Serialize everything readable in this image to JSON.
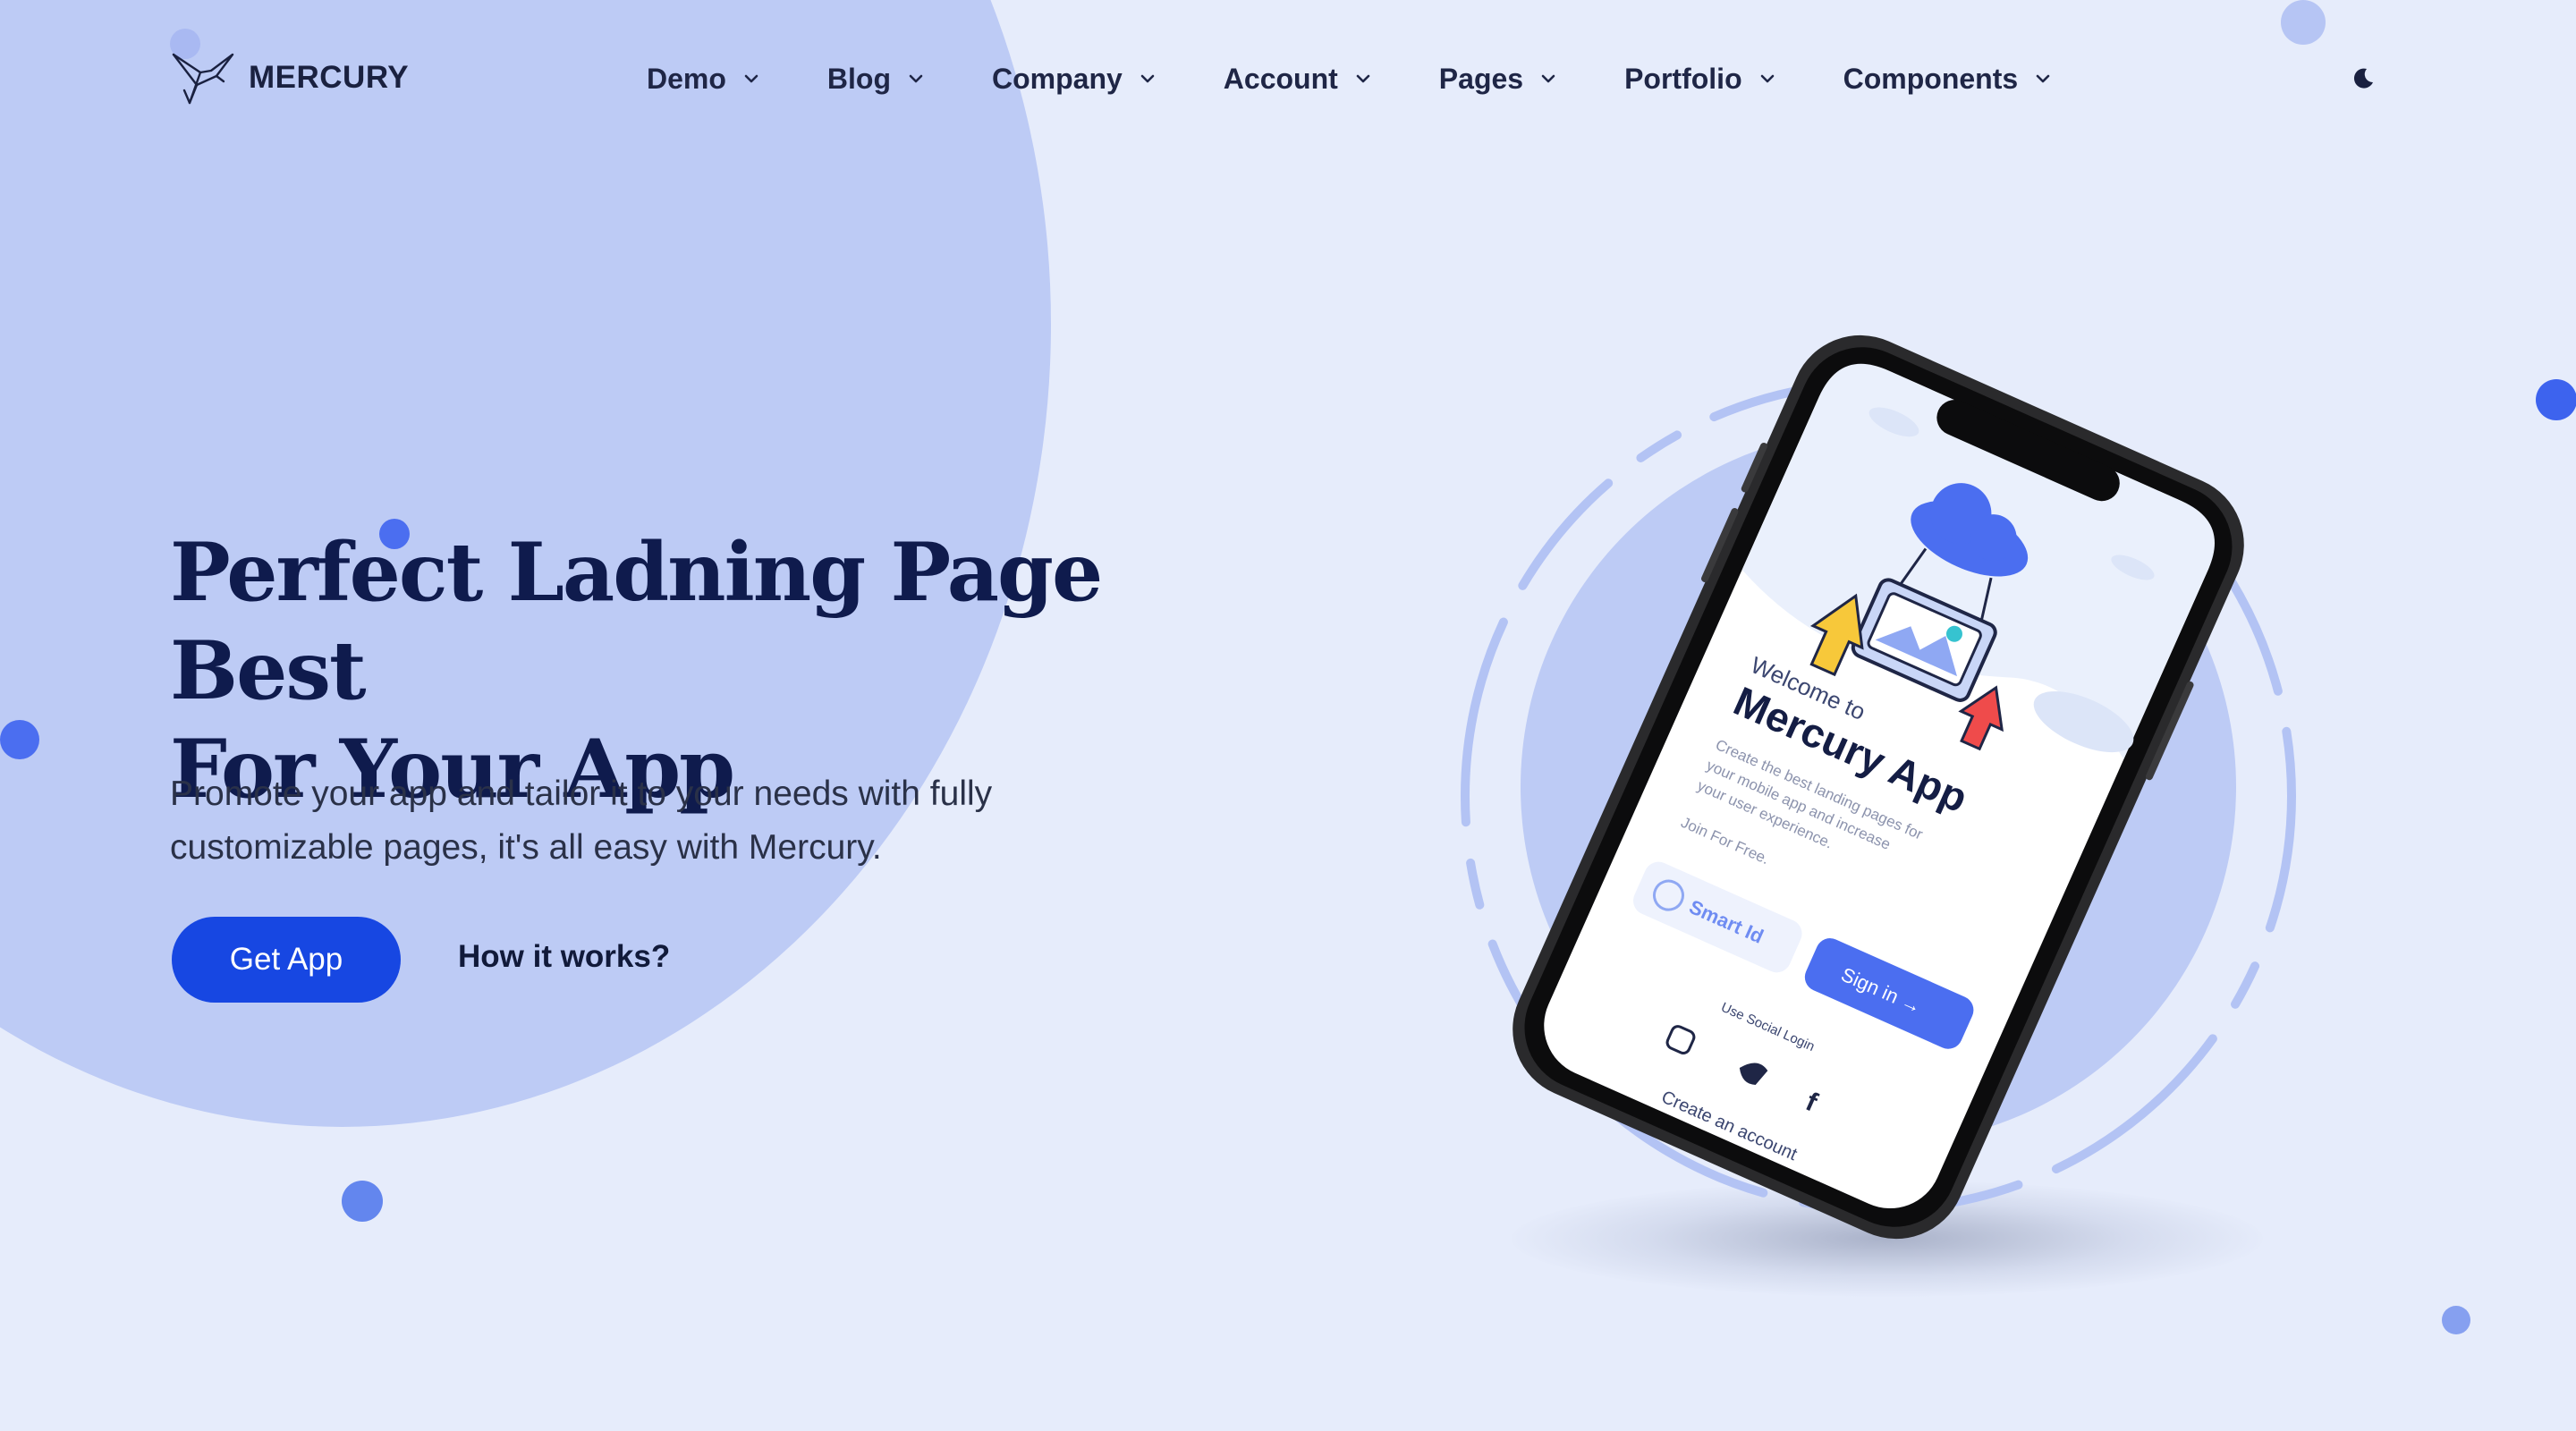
{
  "brand": {
    "name": "MERCURY"
  },
  "nav": {
    "items": [
      {
        "label": "Demo"
      },
      {
        "label": "Blog"
      },
      {
        "label": "Company"
      },
      {
        "label": "Account"
      },
      {
        "label": "Pages"
      },
      {
        "label": "Portfolio"
      },
      {
        "label": "Components"
      }
    ],
    "theme_toggle_icon": "moon-icon"
  },
  "hero": {
    "title_line1": "Perfect Ladning Page Best",
    "title_line2": "For Your App",
    "description_line1": "Promote your app and tailor it to your needs with fully",
    "description_line2": "customizable pages, it's all easy with Mercury.",
    "primary_button": "Get App",
    "secondary_link": "How it works?"
  },
  "phone_screen": {
    "welcome": "Welcome to",
    "app_name": "Mercury App",
    "tagline_line1": "Create the best landing pages for",
    "tagline_line2": "your mobile app and increase",
    "tagline_line3": "your user experience.",
    "join": "Join For Free.",
    "smart_id_button": "Smart Id",
    "sign_in_button": "Sign in →",
    "social_label": "Use Social Login",
    "social_icons": [
      "instagram-icon",
      "twitter-icon",
      "facebook-icon"
    ],
    "create_account": "Create an account"
  },
  "colors": {
    "background": "#e6ecfb",
    "blob": "#bdcbf5",
    "accent": "#1747e2",
    "heading": "#0f1b4d",
    "dot": "#4b6ef0"
  }
}
